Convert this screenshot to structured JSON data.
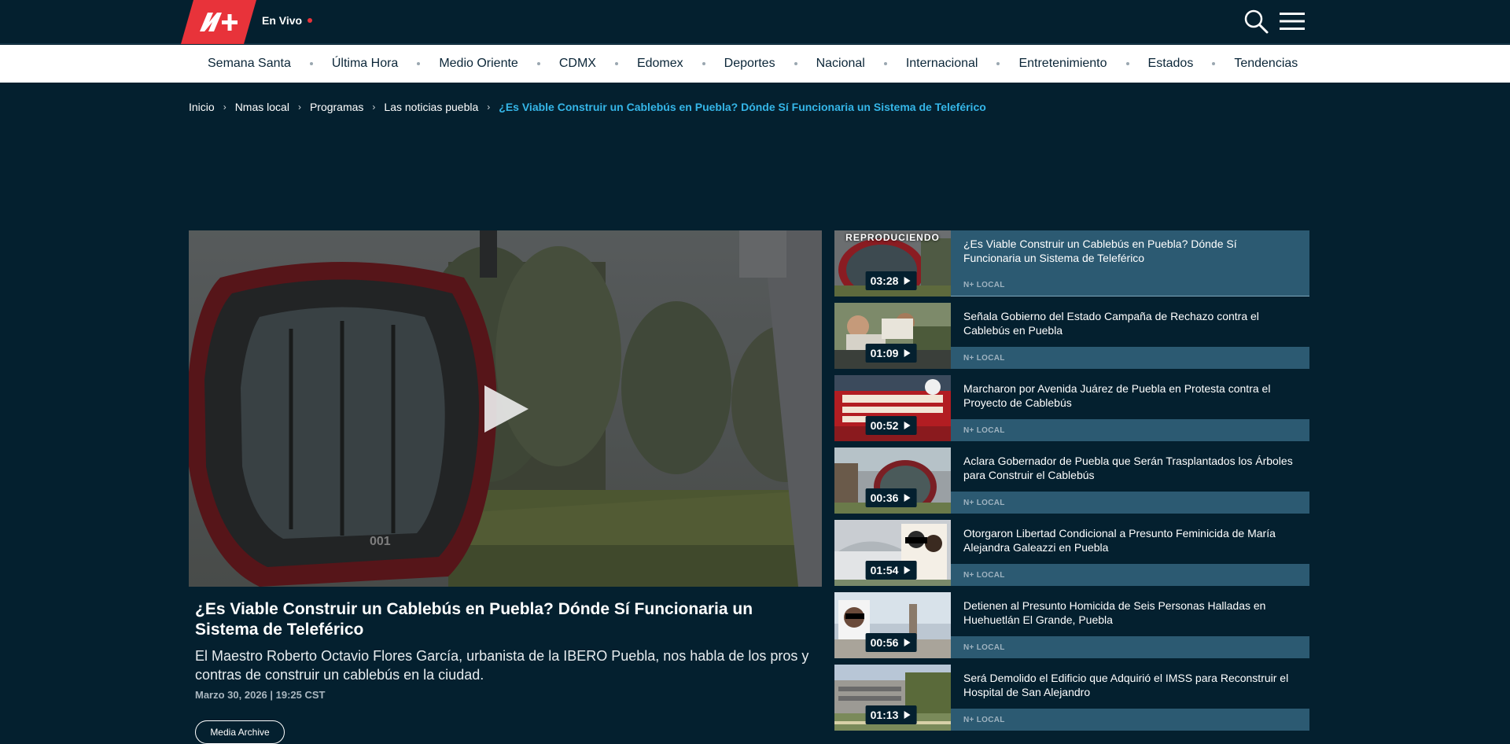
{
  "header": {
    "live_label": "En Vivo"
  },
  "nav": {
    "items": [
      "Semana Santa",
      "Última Hora",
      "Medio Oriente",
      "CDMX",
      "Edomex",
      "Deportes",
      "Nacional",
      "Internacional",
      "Entretenimiento",
      "Estados",
      "Tendencias"
    ]
  },
  "breadcrumb": {
    "items": [
      "Inicio",
      "Nmas local",
      "Programas",
      "Las noticias puebla"
    ],
    "current": "¿Es Viable Construir un Cablebús en Puebla? Dónde Sí Funcionaria un Sistema de Teleférico"
  },
  "video": {
    "title": "¿Es Viable Construir un Cablebús en Puebla? Dónde Sí Funcionaria un Sistema de Teleférico",
    "description": "El Maestro Roberto Octavio Flores García, urbanista de la IBERO Puebla, nos habla de los pros y contras de construir un cablebús en la ciudad.",
    "date": "Marzo 30, 2026 | 19:25 CST",
    "more_button": "Media Archive",
    "cabin_marking": "001"
  },
  "playlist": {
    "playing_label": "REPRODUCIENDO",
    "items": [
      {
        "title": "¿Es Viable Construir un Cablebús en Puebla? Dónde Sí Funcionaria un Sistema de Teleférico",
        "duration": "03:28",
        "tag": "N+ LOCAL",
        "active": true
      },
      {
        "title": "Señala Gobierno del Estado Campaña de Rechazo contra el Cablebús en Puebla",
        "duration": "01:09",
        "tag": "N+ LOCAL",
        "active": false
      },
      {
        "title": "Marcharon por Avenida Juárez de Puebla en Protesta contra el Proyecto de Cablebús",
        "duration": "00:52",
        "tag": "N+ LOCAL",
        "active": false
      },
      {
        "title": "Aclara Gobernador de Puebla que Serán Trasplantados los Árboles para Construir el Cablebús",
        "duration": "00:36",
        "tag": "N+ LOCAL",
        "active": false
      },
      {
        "title": "Otorgaron Libertad Condicional a Presunto Feminicida de María Alejandra Galeazzi en Puebla",
        "duration": "01:54",
        "tag": "N+ LOCAL",
        "active": false
      },
      {
        "title": "Detienen al Presunto Homicida de Seis Personas Halladas en Huehuetlán El Grande, Puebla",
        "duration": "00:56",
        "tag": "N+ LOCAL",
        "active": false
      },
      {
        "title": "Será Demolido el Edificio que Adquirió el IMSS para Reconstruir el Hospital de San Alejandro",
        "duration": "01:13",
        "tag": "N+ LOCAL",
        "active": false
      }
    ]
  },
  "colors": {
    "background": "#04202f",
    "accent_red": "#e8333a",
    "breadcrumb_current": "#35b6e8",
    "playlist_card": "#2c5a72"
  }
}
